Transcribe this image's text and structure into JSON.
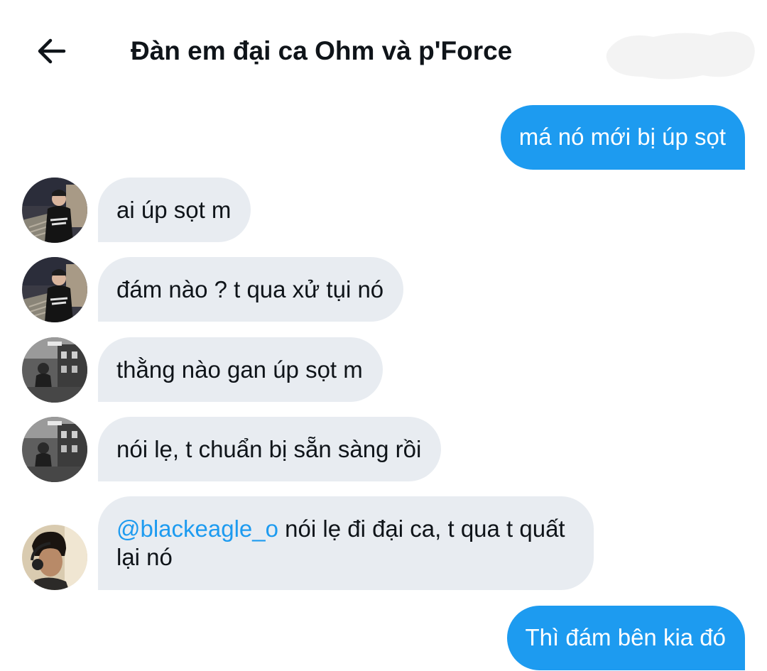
{
  "header": {
    "back_icon": "arrow-left-icon",
    "title": "Đàn em đại ca Ohm và p'Force"
  },
  "messages": [
    {
      "direction": "outgoing",
      "text": "má nó mới bị úp sọt"
    },
    {
      "direction": "incoming",
      "avatar": "avatar-boy-stairs",
      "text": "ai úp sọt m"
    },
    {
      "direction": "incoming",
      "avatar": "avatar-boy-stairs",
      "text": "đám nào ? t qua xử tụi nó"
    },
    {
      "direction": "incoming",
      "avatar": "avatar-street-bw",
      "text": "thằng nào gan úp sọt m"
    },
    {
      "direction": "incoming",
      "avatar": "avatar-street-bw",
      "text": "nói lẹ, t chuẩn bị sẵn sàng rồi"
    },
    {
      "direction": "incoming",
      "avatar": "avatar-headphones",
      "mention": "@blackeagle_o",
      "text": " nói lẹ đi đại ca, t qua t quất lại nó"
    },
    {
      "direction": "outgoing",
      "text": "Thì đám bên kia đó"
    }
  ],
  "colors": {
    "outgoing_bubble": "#1d9bf0",
    "incoming_bubble": "#e8ecf1",
    "mention": "#1d9bf0",
    "text": "#0f1419"
  }
}
